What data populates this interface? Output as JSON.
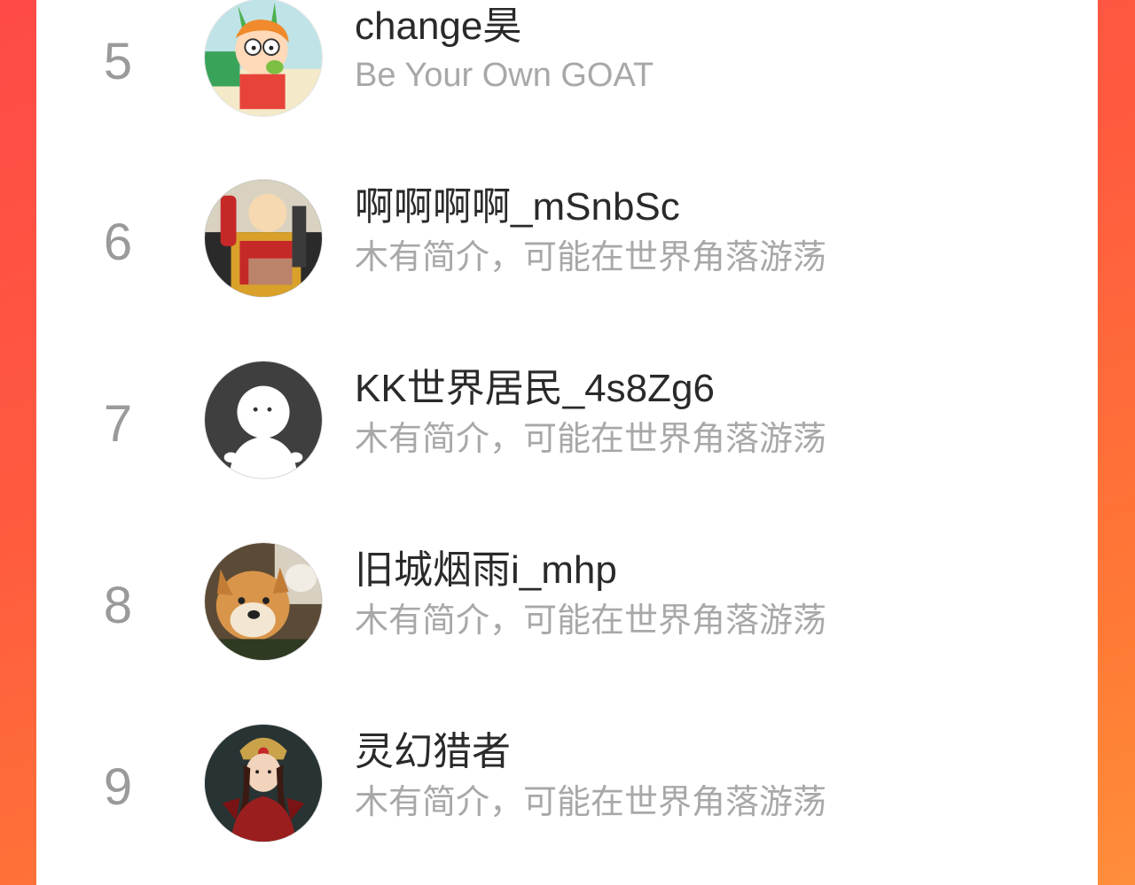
{
  "ranking": {
    "items": [
      {
        "rank": "5",
        "name": "change昊",
        "bio": "Be Your Own GOAT",
        "avatar_icon": "cartoon-boy-avatar"
      },
      {
        "rank": "6",
        "name": "啊啊啊啊_mSnbSc",
        "bio": "木有简介，可能在世界角落游荡",
        "avatar_icon": "bald-hero-avatar"
      },
      {
        "rank": "7",
        "name": "KK世界居民_4s8Zg6",
        "bio": "木有简介，可能在世界角落游荡",
        "avatar_icon": "default-ghost-avatar"
      },
      {
        "rank": "8",
        "name": "旧城烟雨i_mhp",
        "bio": "木有简介，可能在世界角落游荡",
        "avatar_icon": "shiba-dog-avatar"
      },
      {
        "rank": "9",
        "name": "灵幻猎者",
        "bio": "木有简介，可能在世界角落游荡",
        "avatar_icon": "fantasy-warrior-avatar"
      }
    ]
  }
}
